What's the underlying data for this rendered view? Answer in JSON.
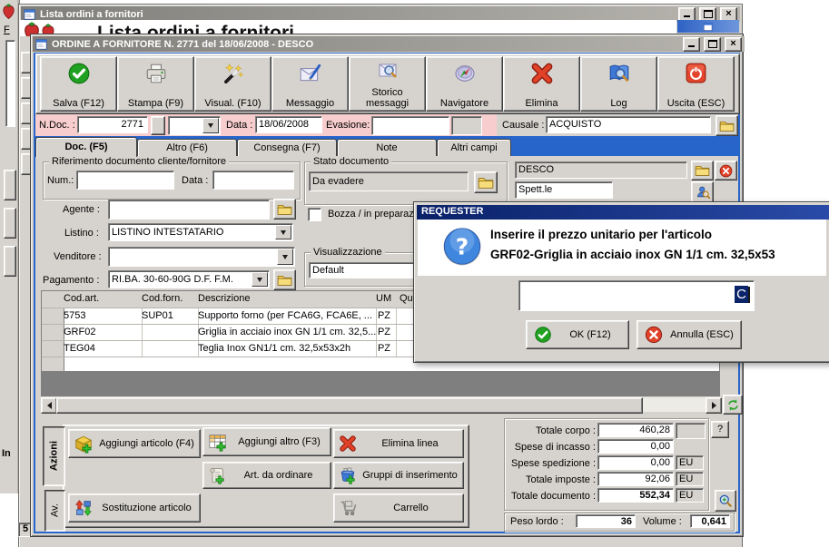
{
  "back_window": {
    "title": "Lista ordini a fornitori",
    "clipped_title": "Lista ordini a fornitori",
    "record_count": "5"
  },
  "left_panel": {
    "f_label": "F",
    "in_label": "In"
  },
  "window": {
    "title": "ORDINE A FORNITORE N. 2771  del 18/06/2008 - DESCO",
    "toolbar": [
      {
        "label": "Salva (F12)",
        "icon": "save-check-icon"
      },
      {
        "label": "Stampa (F9)",
        "icon": "printer-icon"
      },
      {
        "label": "Visual. (F10)",
        "icon": "magic-wand-icon"
      },
      {
        "label": "Messaggio",
        "icon": "envelope-pen-icon"
      },
      {
        "label": "Storico messaggi",
        "icon": "envelope-search-icon"
      },
      {
        "label": "Navigatore",
        "icon": "compass-icon"
      },
      {
        "label": "Elimina",
        "icon": "red-x-icon"
      },
      {
        "label": "Log",
        "icon": "book-search-icon"
      },
      {
        "label": "Uscita (ESC)",
        "icon": "power-icon"
      }
    ],
    "doc_header": {
      "ndoc_label": "N.Doc. :",
      "ndoc_value": "2771",
      "data_label": "Data :",
      "data_value": "18/06/2008",
      "evasione_label": "Evasione:",
      "causale_label": "Causale :",
      "causale_value": "ACQUISTO"
    },
    "tabs": [
      "Doc. (F5)",
      "Altro (F6)",
      "Consegna (F7)",
      "Note",
      "Altri campi"
    ],
    "form": {
      "rif_group_title": "Riferimento documento cliente/fornitore",
      "num_label": "Num.:",
      "data_label": "Data :",
      "agente_label": "Agente :",
      "listino_label": "Listino :",
      "listino_value": "LISTINO INTESTATARIO",
      "venditore_label": "Venditore :",
      "pagamento_label": "Pagamento :",
      "pagamento_value": "RI.BA. 30-60-90G D.F. F.M.",
      "stato_group_title": "Stato documento",
      "stato_value": "Da evadere",
      "bozza_label": "Bozza / in preparazione",
      "visualizzazione_group_title": "Visualizzazione",
      "visualizzazione_value": "Default",
      "fornitore_value": "DESCO",
      "spettle_value": "Spett.le"
    },
    "table": {
      "headers": [
        "Cod.art.",
        "Cod.forn.",
        "Descrizione",
        "UM",
        "Qua"
      ],
      "rows": [
        [
          "5753",
          "SUP01",
          "Supporto forno  (per FCA6G, FCA6E, ...",
          "PZ"
        ],
        [
          "GRF02",
          "",
          "Griglia in acciaio inox GN 1/1 cm. 32,5...",
          "PZ"
        ],
        [
          "TEG04",
          "",
          "Teglia Inox GN1/1 cm. 32,5x53x2h",
          "PZ"
        ]
      ]
    },
    "actions": {
      "tab_azioni": "Azioni",
      "tab_av": "Av.",
      "aggiungi_articolo": "Aggiungi articolo (F4)",
      "aggiungi_altro": "Aggiungi altro (F3)",
      "elimina_linea": "Elimina linea",
      "art_da_ordinare": "Art. da ordinare",
      "gruppi_inserimento": "Gruppi di inserimento",
      "sostituzione_articolo": "Sostituzione articolo",
      "carrello": "Carrello"
    },
    "totals": {
      "totale_corpo_label": "Totale corpo :",
      "totale_corpo_value": "460,28",
      "spese_incasso_label": "Spese di incasso :",
      "spese_incasso_value": "0,00",
      "spese_spedizione_label": "Spese spedizione :",
      "spese_spedizione_value": "0,00",
      "totale_imposte_label": "Totale imposte :",
      "totale_imposte_value": "92,06",
      "totale_documento_label": "Totale documento :",
      "totale_documento_value": "552,34",
      "currency": "EU",
      "help_button": "?",
      "peso_lordo_label": "Peso lordo :",
      "peso_lordo_value": "36",
      "volume_label": "Volume :",
      "volume_value": "0,641"
    }
  },
  "dialog": {
    "title": "REQUESTER",
    "message_line1": "Inserire il prezzo unitario per l'articolo",
    "message_line2": "GRF02-Griglia in acciaio inox GN 1/1 cm. 32,5x53",
    "input_value": "C",
    "ok_label": "OK (F12)",
    "cancel_label": "Annulla (ESC)"
  },
  "colors": {
    "frame_blue": "#2765CB",
    "pink_row": "#F7CDCD",
    "dialog_titlebar": "#0A2168",
    "base_gray": "#D6D3CE",
    "selection_navy": "#0A246A"
  }
}
